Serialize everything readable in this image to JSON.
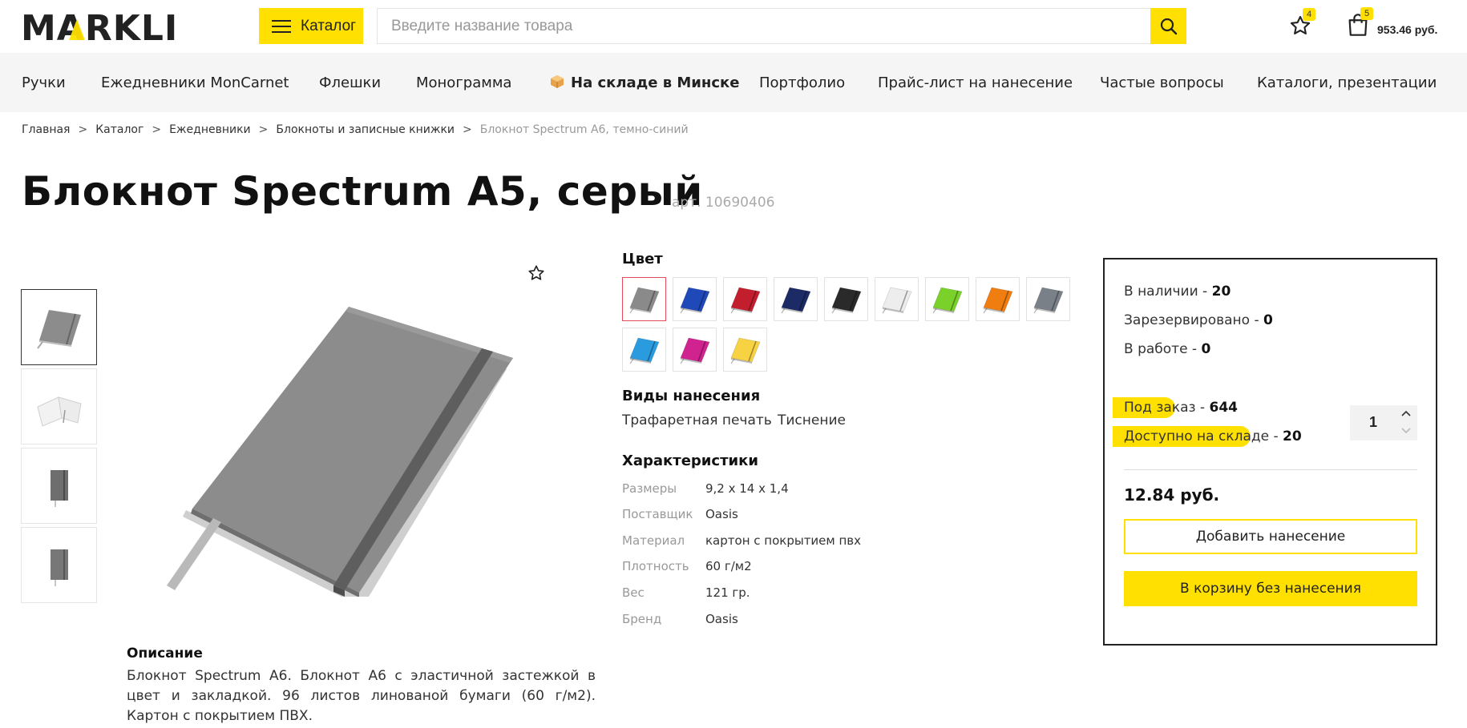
{
  "header": {
    "logo_text": "MARKLI",
    "catalog_label": "Каталог",
    "search_placeholder": "Введите название товара",
    "favorites_count": "4",
    "cart_count": "5",
    "cart_total": "953.46 руб."
  },
  "nav": {
    "items": [
      "Ручки",
      "Ежедневники MonCarnet",
      "Флешки",
      "Монограмма",
      "На складе в Минске",
      "Портфолио",
      "Прайс-лист на нанесение",
      "Частые вопросы",
      "Каталоги, презентации"
    ]
  },
  "breadcrumbs": [
    "Главная",
    "Каталог",
    "Ежедневники",
    "Блокноты и записные книжки",
    "Блокнот Spectrum A6, темно-синий"
  ],
  "breadcrumb_separator": ">",
  "product": {
    "title": "Блокнот Spectrum A5, серый",
    "sku": "арт. 10690406",
    "color_label": "Цвет",
    "colors": [
      "#8a8a8a",
      "#1f48b8",
      "#c31e2d",
      "#1c2a66",
      "#2a2a2a",
      "#ededed",
      "#7ad12a",
      "#f07d10",
      "#7a8088",
      "#2b9be0",
      "#d0238f",
      "#f7d243"
    ],
    "methods_label": "Виды нанесения",
    "methods": [
      "Трафаретная печать",
      "Тиснение"
    ],
    "specs_label": "Характеристики",
    "specs": [
      {
        "key": "Размеры",
        "value": "9,2 х 14 х 1,4"
      },
      {
        "key": "Поставщик",
        "value": "Oasis"
      },
      {
        "key": "Материал",
        "value": "картон с покрытием пвх"
      },
      {
        "key": "Плотность",
        "value": "60 г/м2"
      },
      {
        "key": "Вес",
        "value": "121 гр."
      },
      {
        "key": "Бренд",
        "value": "Oasis"
      }
    ],
    "description_title": "Описание",
    "description": "Блокнот Spectrum A6. Блокнот А6 с эластичной застежкой в цвет и закладкой. 96 листов линованой бумаги (60 г/м2). Картон с покрытием ПВХ."
  },
  "stock": {
    "in_stock_label": "В наличии - ",
    "in_stock": "20",
    "reserved_label": "Зарезервировано - ",
    "reserved": "0",
    "in_work_label": "В работе - ",
    "in_work": "0",
    "on_order_label": "Под заказ",
    "on_order": "644",
    "available_label": "Доступно на складе",
    "available": "20",
    "dash": " - ",
    "quantity": "1",
    "price": "12.84 руб.",
    "add_print_label": "Добавить нанесение",
    "add_cart_label": "В корзину без нанесения"
  },
  "colors": {
    "accent": "#ffe000",
    "active_swatch_border": "#e34d5b",
    "notebook_body": "#8c8c8c"
  }
}
